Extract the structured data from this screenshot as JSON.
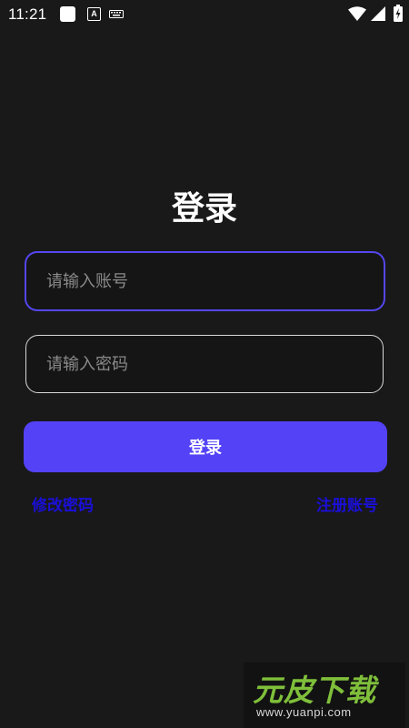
{
  "status_bar": {
    "time": "11:21"
  },
  "login": {
    "title": "登录",
    "account_placeholder": "请输入账号",
    "password_placeholder": "请输入密码",
    "login_button_label": "登录",
    "change_password_link": "修改密码",
    "register_link": "注册账号"
  },
  "colors": {
    "background": "#191919",
    "accent": "#5442f7",
    "link": "#1a0fd8",
    "focused_border": "#5446ef"
  },
  "watermark": {
    "brand": "元皮下载",
    "url": "www.yuanpi.com"
  }
}
